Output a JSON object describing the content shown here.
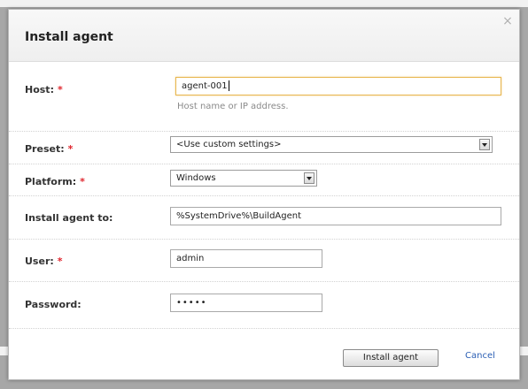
{
  "dialog": {
    "title": "Install agent",
    "close_glyph": "×"
  },
  "form": {
    "host": {
      "label": "Host:",
      "required_mark": "*",
      "value": "agent-001",
      "hint": "Host name or IP address."
    },
    "preset": {
      "label": "Preset:",
      "required_mark": "*",
      "selected": "<Use custom settings>"
    },
    "platform": {
      "label": "Platform:",
      "required_mark": "*",
      "selected": "Windows"
    },
    "install_to": {
      "label": "Install agent to:",
      "value": "%SystemDrive%\\BuildAgent"
    },
    "user": {
      "label": "User:",
      "required_mark": "*",
      "value": "admin"
    },
    "password": {
      "label": "Password:",
      "value": "•••••"
    }
  },
  "footer": {
    "install_label": "Install agent",
    "cancel_label": "Cancel"
  },
  "colors": {
    "required": "#e0262e",
    "link": "#2b5fb4",
    "focus_border": "#e8b64f"
  },
  "icons": {
    "close": "close-icon",
    "dropdown": "chevron-down-icon"
  }
}
